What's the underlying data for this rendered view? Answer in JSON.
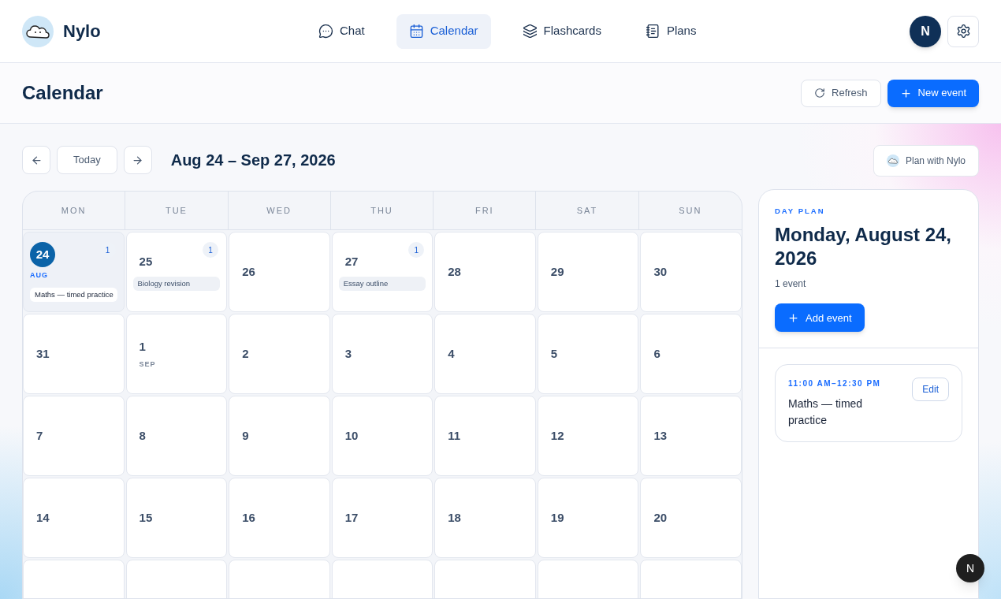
{
  "brand": {
    "name": "Nylo"
  },
  "nav": [
    {
      "label": "Chat",
      "selected": false
    },
    {
      "label": "Calendar",
      "selected": true
    },
    {
      "label": "Flashcards",
      "selected": false
    },
    {
      "label": "Plans",
      "selected": false
    }
  ],
  "user": {
    "initial": "N"
  },
  "page": {
    "title": "Calendar",
    "actions": [
      {
        "label": "Refresh",
        "kind": "secondary"
      },
      {
        "label": "New event",
        "kind": "primary"
      }
    ]
  },
  "toolbar": {
    "today": "Today",
    "range": "Aug 24 – Sep 27, 2026",
    "assistant": "Plan with Nylo"
  },
  "weekdays": [
    "MON",
    "TUE",
    "WED",
    "THU",
    "FRI",
    "SAT",
    "SUN"
  ],
  "weeks": [
    [
      {
        "day": "24",
        "month": "AUG",
        "count": "1",
        "event": "Maths — timed practice",
        "selected": true
      },
      {
        "day": "25",
        "count": "1",
        "event": "Biology revision",
        "selected": false
      },
      {
        "day": "26",
        "selected": false
      },
      {
        "day": "27",
        "count": "1",
        "event": "Essay outline",
        "selected": false
      },
      {
        "day": "28",
        "selected": false
      },
      {
        "day": "29",
        "selected": false
      },
      {
        "day": "30",
        "selected": false
      }
    ],
    [
      {
        "day": "31",
        "selected": false
      },
      {
        "day": "1",
        "month": "SEP",
        "selected": false
      },
      {
        "day": "2",
        "selected": false
      },
      {
        "day": "3",
        "selected": false
      },
      {
        "day": "4",
        "selected": false
      },
      {
        "day": "5",
        "selected": false
      },
      {
        "day": "6",
        "selected": false
      }
    ],
    [
      {
        "day": "7",
        "selected": false
      },
      {
        "day": "8",
        "selected": false
      },
      {
        "day": "9",
        "selected": false
      },
      {
        "day": "10",
        "selected": false
      },
      {
        "day": "11",
        "selected": false
      },
      {
        "day": "12",
        "selected": false
      },
      {
        "day": "13",
        "selected": false
      }
    ],
    [
      {
        "day": "14",
        "selected": false
      },
      {
        "day": "15",
        "selected": false
      },
      {
        "day": "16",
        "selected": false
      },
      {
        "day": "17",
        "selected": false
      },
      {
        "day": "18",
        "selected": false
      },
      {
        "day": "19",
        "selected": false
      },
      {
        "day": "20",
        "selected": false
      }
    ],
    [
      {
        "selected": false
      },
      {
        "selected": false
      },
      {
        "selected": false
      },
      {
        "selected": false
      },
      {
        "selected": false
      },
      {
        "selected": false
      },
      {
        "selected": false
      }
    ]
  ],
  "day_plan": {
    "label": "DAY PLAN",
    "title": "Monday, August 24, 2026",
    "count": "1 event",
    "add": "Add event",
    "events": [
      {
        "time": "11:00 AM–12:30 PM",
        "title": "Maths — timed practice",
        "edit": "Edit"
      }
    ]
  },
  "dev_badge": "N"
}
